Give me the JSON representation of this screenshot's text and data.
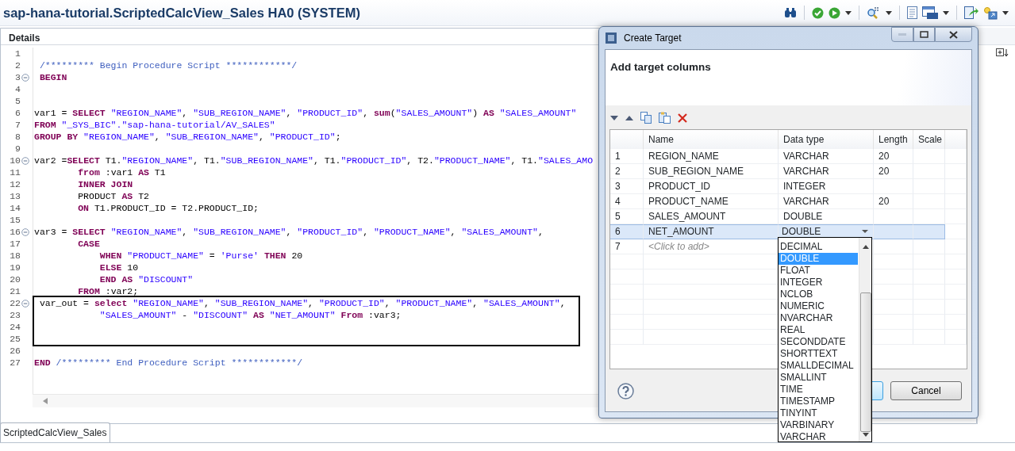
{
  "window": {
    "title": "sap-hana-tutorial.ScriptedCalcView_Sales HA0 (SYSTEM)"
  },
  "editor": {
    "header": "Details",
    "blocks": [
      {
        "boxed": false,
        "lines": [
          {
            "number": "1",
            "fold": false
          },
          {
            "number": "2",
            "fold": false,
            "tokens": [
              {
                "kind": "comment",
                "text": " /********* Begin Procedure Script ************/"
              }
            ]
          },
          {
            "number": "3",
            "fold": true,
            "tokens": [
              {
                "kind": "keyword",
                "text": " BEGIN"
              }
            ]
          },
          {
            "number": "4",
            "fold": false
          },
          {
            "number": "5",
            "fold": false
          },
          {
            "number": "6",
            "fold": false,
            "tokens": [
              {
                "kind": "plain",
                "text": "var1 = "
              },
              {
                "kind": "keyword",
                "text": "SELECT"
              },
              {
                "kind": "string",
                "text": " \"REGION_NAME\""
              },
              {
                "kind": "plain",
                "text": ", "
              },
              {
                "kind": "string",
                "text": "\"SUB_REGION_NAME\""
              },
              {
                "kind": "plain",
                "text": ", "
              },
              {
                "kind": "string",
                "text": "\"PRODUCT_ID\""
              },
              {
                "kind": "plain",
                "text": ", "
              },
              {
                "kind": "keyword",
                "text": "sum"
              },
              {
                "kind": "plain",
                "text": "("
              },
              {
                "kind": "string",
                "text": "\"SALES_AMOUNT\""
              },
              {
                "kind": "plain",
                "text": ") "
              },
              {
                "kind": "keyword",
                "text": "AS"
              },
              {
                "kind": "string",
                "text": " \"SALES_AMOUNT\""
              }
            ]
          },
          {
            "number": "7",
            "fold": false,
            "tokens": [
              {
                "kind": "keyword",
                "text": "FROM"
              },
              {
                "kind": "string",
                "text": " \"_SYS_BIC\".\"sap-hana-tutorial/AV_SALES\""
              }
            ]
          },
          {
            "number": "8",
            "fold": false,
            "tokens": [
              {
                "kind": "keyword",
                "text": "GROUP BY"
              },
              {
                "kind": "string",
                "text": " \"REGION_NAME\""
              },
              {
                "kind": "plain",
                "text": ", "
              },
              {
                "kind": "string",
                "text": "\"SUB_REGION_NAME\""
              },
              {
                "kind": "plain",
                "text": ", "
              },
              {
                "kind": "string",
                "text": "\"PRODUCT_ID\""
              },
              {
                "kind": "plain",
                "text": ";"
              }
            ]
          },
          {
            "number": "9",
            "fold": false
          },
          {
            "number": "10",
            "fold": true,
            "tokens": [
              {
                "kind": "plain",
                "text": "var2 ="
              },
              {
                "kind": "keyword",
                "text": "SELECT"
              },
              {
                "kind": "plain",
                "text": " T1."
              },
              {
                "kind": "string",
                "text": "\"REGION_NAME\""
              },
              {
                "kind": "plain",
                "text": ", T1."
              },
              {
                "kind": "string",
                "text": "\"SUB_REGION_NAME\""
              },
              {
                "kind": "plain",
                "text": ", T1."
              },
              {
                "kind": "string",
                "text": "\"PRODUCT_ID\""
              },
              {
                "kind": "plain",
                "text": ", T2."
              },
              {
                "kind": "string",
                "text": "\"PRODUCT_NAME\""
              },
              {
                "kind": "plain",
                "text": ", T1."
              },
              {
                "kind": "string",
                "text": "\"SALES_AMO"
              }
            ]
          },
          {
            "number": "11",
            "fold": false,
            "tokens": [
              {
                "kind": "keyword",
                "text": "        from"
              },
              {
                "kind": "plain",
                "text": " :var1 "
              },
              {
                "kind": "keyword",
                "text": "AS"
              },
              {
                "kind": "plain",
                "text": " T1"
              }
            ]
          },
          {
            "number": "12",
            "fold": false,
            "tokens": [
              {
                "kind": "keyword",
                "text": "        INNER JOIN"
              }
            ]
          },
          {
            "number": "13",
            "fold": false,
            "tokens": [
              {
                "kind": "plain",
                "text": "        PRODUCT "
              },
              {
                "kind": "keyword",
                "text": "AS"
              },
              {
                "kind": "plain",
                "text": " T2"
              }
            ]
          },
          {
            "number": "14",
            "fold": false,
            "tokens": [
              {
                "kind": "keyword",
                "text": "        ON"
              },
              {
                "kind": "plain",
                "text": " T1.PRODUCT_ID = T2.PRODUCT_ID;"
              }
            ]
          },
          {
            "number": "15",
            "fold": false
          },
          {
            "number": "16",
            "fold": true,
            "tokens": [
              {
                "kind": "plain",
                "text": "var3 = "
              },
              {
                "kind": "keyword",
                "text": "SELECT"
              },
              {
                "kind": "string",
                "text": " \"REGION_NAME\""
              },
              {
                "kind": "plain",
                "text": ", "
              },
              {
                "kind": "string",
                "text": "\"SUB_REGION_NAME\""
              },
              {
                "kind": "plain",
                "text": ", "
              },
              {
                "kind": "string",
                "text": "\"PRODUCT_ID\""
              },
              {
                "kind": "plain",
                "text": ", "
              },
              {
                "kind": "string",
                "text": "\"PRODUCT_NAME\""
              },
              {
                "kind": "plain",
                "text": ", "
              },
              {
                "kind": "string",
                "text": "\"SALES_AMOUNT\""
              },
              {
                "kind": "plain",
                "text": ","
              }
            ]
          },
          {
            "number": "17",
            "fold": false,
            "tokens": [
              {
                "kind": "keyword",
                "text": "        CASE"
              }
            ]
          },
          {
            "number": "18",
            "fold": false,
            "tokens": [
              {
                "kind": "keyword",
                "text": "            WHEN"
              },
              {
                "kind": "string",
                "text": " \"PRODUCT_NAME\""
              },
              {
                "kind": "plain",
                "text": " = "
              },
              {
                "kind": "string",
                "text": "'Purse'"
              },
              {
                "kind": "keyword",
                "text": " THEN"
              },
              {
                "kind": "plain",
                "text": " 20"
              }
            ]
          },
          {
            "number": "19",
            "fold": false,
            "tokens": [
              {
                "kind": "keyword",
                "text": "            ELSE"
              },
              {
                "kind": "plain",
                "text": " 10"
              }
            ]
          },
          {
            "number": "20",
            "fold": false,
            "tokens": [
              {
                "kind": "keyword",
                "text": "            END AS"
              },
              {
                "kind": "string",
                "text": " \"DISCOUNT\""
              }
            ]
          },
          {
            "number": "21",
            "fold": false,
            "tokens": [
              {
                "kind": "keyword",
                "text": "        FROM"
              },
              {
                "kind": "plain",
                "text": " :var2;"
              }
            ]
          }
        ]
      },
      {
        "boxed": true,
        "lines": [
          {
            "number": "22",
            "fold": true,
            "tokens": [
              {
                "kind": "plain",
                "text": " var_out = "
              },
              {
                "kind": "keyword",
                "text": "select"
              },
              {
                "kind": "string",
                "text": " \"REGION_NAME\""
              },
              {
                "kind": "plain",
                "text": ", "
              },
              {
                "kind": "string",
                "text": "\"SUB_REGION_NAME\""
              },
              {
                "kind": "plain",
                "text": ", "
              },
              {
                "kind": "string",
                "text": "\"PRODUCT_ID\""
              },
              {
                "kind": "plain",
                "text": ", "
              },
              {
                "kind": "string",
                "text": "\"PRODUCT_NAME\""
              },
              {
                "kind": "plain",
                "text": ", "
              },
              {
                "kind": "string",
                "text": "\"SALES_AMOUNT\""
              },
              {
                "kind": "plain",
                "text": ","
              }
            ]
          },
          {
            "number": "23",
            "fold": false,
            "tokens": [
              {
                "kind": "string",
                "text": "            \"SALES_AMOUNT\""
              },
              {
                "kind": "plain",
                "text": " - "
              },
              {
                "kind": "string",
                "text": "\"DISCOUNT\""
              },
              {
                "kind": "keyword",
                "text": " AS"
              },
              {
                "kind": "string",
                "text": " \"NET_AMOUNT\""
              },
              {
                "kind": "keyword",
                "text": " From"
              },
              {
                "kind": "plain",
                "text": " :var3;"
              }
            ]
          },
          {
            "number": "24",
            "fold": false
          },
          {
            "number": "25",
            "fold": false
          }
        ]
      },
      {
        "boxed": false,
        "lines": [
          {
            "number": "26",
            "fold": false
          },
          {
            "number": "27",
            "fold": false,
            "tokens": [
              {
                "kind": "keyword",
                "text": "END"
              },
              {
                "kind": "comment",
                "text": " /********* End Procedure Script ************/"
              }
            ]
          }
        ]
      }
    ]
  },
  "editor_tab": {
    "label": "ScriptedCalcView_Sales",
    "selected": true
  },
  "dialog": {
    "title": "Create Target",
    "heading": "Add target columns",
    "table": {
      "columns": [
        "Name",
        "Data type",
        "Length",
        "Scale"
      ],
      "rows": [
        {
          "number": "1",
          "name": "REGION_NAME",
          "data_type": "VARCHAR",
          "length": "20",
          "selected": false
        },
        {
          "number": "2",
          "name": "SUB_REGION_NAME",
          "data_type": "VARCHAR",
          "length": "20",
          "selected": false
        },
        {
          "number": "3",
          "name": "PRODUCT_ID",
          "data_type": "INTEGER",
          "selected": false
        },
        {
          "number": "4",
          "name": "PRODUCT_NAME",
          "data_type": "VARCHAR",
          "length": "20",
          "selected": false
        },
        {
          "number": "5",
          "name": "SALES_AMOUNT",
          "data_type": "DOUBLE",
          "selected": false
        },
        {
          "number": "6",
          "name": "NET_AMOUNT",
          "data_type": "DOUBLE",
          "selected": true
        },
        {
          "number": "7",
          "placeholder": "<Click to add>",
          "selected": false
        }
      ]
    },
    "dropdown": {
      "options": [
        {
          "label": "DECIMAL",
          "selected": false
        },
        {
          "label": "DOUBLE",
          "selected": true
        },
        {
          "label": "FLOAT",
          "selected": false
        },
        {
          "label": "INTEGER",
          "selected": false
        },
        {
          "label": "NCLOB",
          "selected": false
        },
        {
          "label": "NUMERIC",
          "selected": false
        },
        {
          "label": "NVARCHAR",
          "selected": false
        },
        {
          "label": "REAL",
          "selected": false
        },
        {
          "label": "SECONDDATE",
          "selected": false
        },
        {
          "label": "SHORTTEXT",
          "selected": false
        },
        {
          "label": "SMALLDECIMAL",
          "selected": false
        },
        {
          "label": "SMALLINT",
          "selected": false
        },
        {
          "label": "TIME",
          "selected": false
        },
        {
          "label": "TIMESTAMP",
          "selected": false
        },
        {
          "label": "TINYINT",
          "selected": false
        },
        {
          "label": "VARBINARY",
          "selected": false
        },
        {
          "label": "VARCHAR",
          "selected": false
        }
      ]
    },
    "buttons": [
      "Cancel"
    ]
  }
}
